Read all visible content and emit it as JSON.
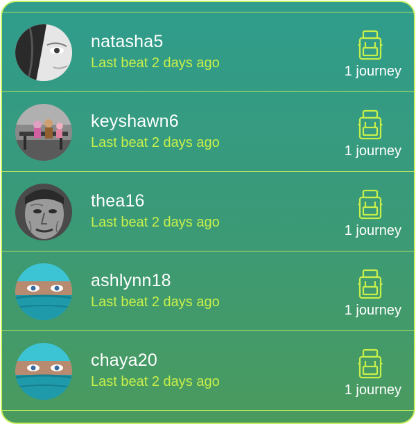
{
  "accent_color": "#c8f04a",
  "journey_icon_name": "backpack-icon",
  "users": [
    {
      "username": "natasha5",
      "last_beat": "Last beat 2 days ago",
      "journeys": "1 journey",
      "avatar": "grayscale-face-hair"
    },
    {
      "username": "keyshawn6",
      "last_beat": "Last beat 2 days ago",
      "journeys": "1 journey",
      "avatar": "children-on-bench-photo"
    },
    {
      "username": "thea16",
      "last_beat": "Last beat 2 days ago",
      "journeys": "1 journey",
      "avatar": "elderly-man-face"
    },
    {
      "username": "ashlynn18",
      "last_beat": "Last beat 2 days ago",
      "journeys": "1 journey",
      "avatar": "face-teal-scarf"
    },
    {
      "username": "chaya20",
      "last_beat": "Last beat 2 days ago",
      "journeys": "1 journey",
      "avatar": "face-teal-scarf"
    }
  ]
}
